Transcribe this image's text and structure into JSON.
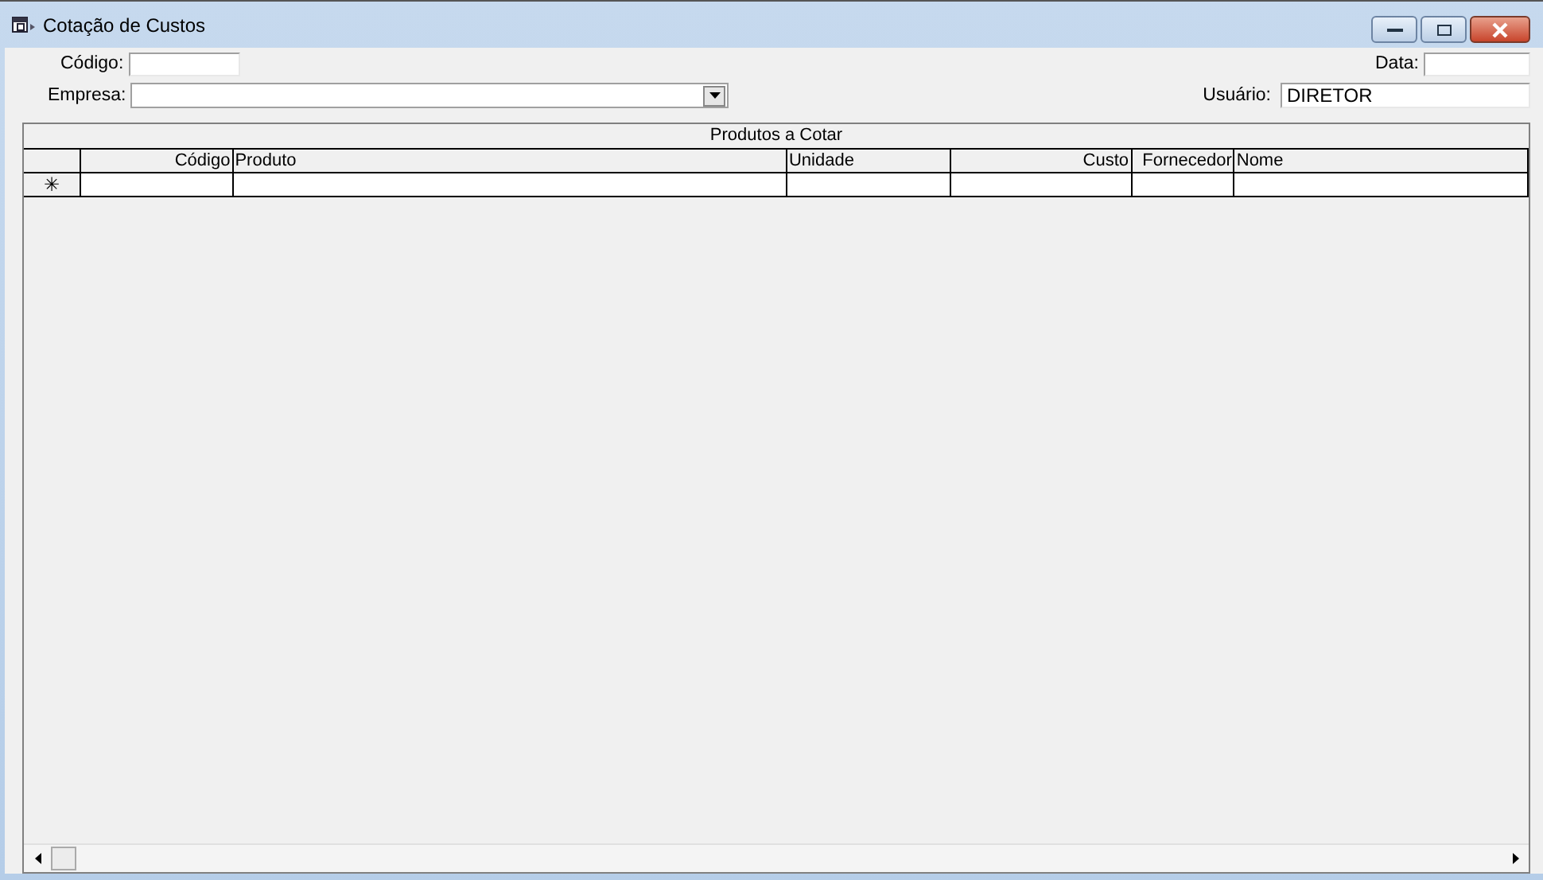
{
  "window": {
    "title": "Cotação de Custos"
  },
  "form": {
    "codigo": {
      "label": "Código:"
    },
    "data": {
      "label": "Data:"
    },
    "empresa": {
      "label": "Empresa:"
    },
    "usuario": {
      "label": "Usuário:",
      "value": "DIRETOR"
    }
  },
  "table": {
    "title": "Produtos a Cotar",
    "columns": [
      {
        "label": "Código"
      },
      {
        "label": "Produto"
      },
      {
        "label": "Unidade"
      },
      {
        "label": "Custo"
      },
      {
        "label": "Fornecedor"
      },
      {
        "label": "Nome"
      }
    ],
    "new_row_marker": "✳"
  }
}
